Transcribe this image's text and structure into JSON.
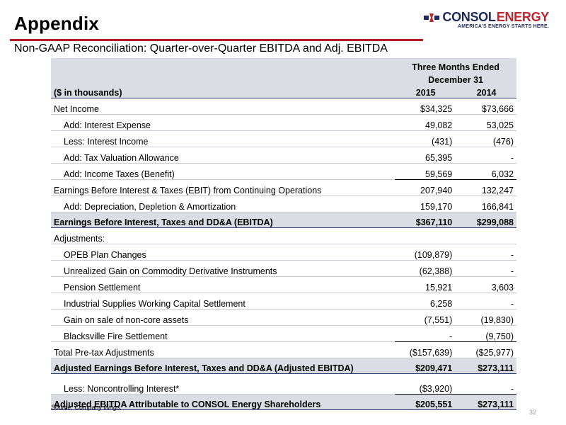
{
  "header": {
    "title": "Appendix",
    "subtitle": "Non-GAAP Reconciliation: Quarter-over-Quarter EBITDA and Adj. EBITDA"
  },
  "logo": {
    "name_part1": "CONSOL",
    "name_part2": "ENERGY",
    "tagline": "AMERICA'S ENERGY STARTS HERE.",
    "brand_red": "#c0262d",
    "brand_blue": "#1f2a5a"
  },
  "table": {
    "period_header_line1": "Three Months Ended",
    "period_header_line2": "December 31",
    "units_label": "($ in thousands)",
    "col_2015": "2015",
    "col_2014": "2014",
    "rows": [
      {
        "label": "Net Income",
        "v2015": "$34,325",
        "v2014": "$73,666"
      },
      {
        "label": "Add: Interest Expense",
        "v2015": "49,082",
        "v2014": "53,025"
      },
      {
        "label": "Less: Interest Income",
        "v2015": "(431)",
        "v2014": "(476)"
      },
      {
        "label": "Add: Tax Valuation Allowance",
        "v2015": "65,395",
        "v2014": "-"
      },
      {
        "label": "Add: Income Taxes (Benefit)",
        "v2015": "59,569",
        "v2014": "6,032"
      },
      {
        "label": "Earnings Before Interest & Taxes  (EBIT) from Continuing Operations",
        "v2015": "207,940",
        "v2014": "132,247"
      },
      {
        "label": "Add: Depreciation, Depletion & Amortization",
        "v2015": "159,170",
        "v2014": "166,841"
      },
      {
        "label": "Earnings Before Interest, Taxes and DD&A (EBITDA)",
        "v2015": "$367,110",
        "v2014": "$299,088"
      },
      {
        "label": "Adjustments:",
        "v2015": "",
        "v2014": ""
      },
      {
        "label": "OPEB Plan Changes",
        "v2015": "(109,879)",
        "v2014": "-"
      },
      {
        "label": "Unrealized Gain on Commodity Derivative Instruments",
        "v2015": "(62,388)",
        "v2014": "-"
      },
      {
        "label": "Pension Settlement",
        "v2015": "15,921",
        "v2014": "3,603"
      },
      {
        "label": "Industrial Supplies Working Capital Settlement",
        "v2015": "6,258",
        "v2014": "-"
      },
      {
        "label": "Gain on sale of non-core assets",
        "v2015": "(7,551)",
        "v2014": "(19,830)"
      },
      {
        "label": "Blacksville Fire Settlement",
        "v2015": "-",
        "v2014": "(9,750)"
      },
      {
        "label": "Total Pre-tax Adjustments",
        "v2015": "($157,639)",
        "v2014": "($25,977)"
      },
      {
        "label": "Adjusted Earnings Before Interest, Taxes and DD&A (Adjusted EBITDA)",
        "v2015": "$209,471",
        "v2014": "$273,111"
      },
      {
        "label": "Less: Noncontrolling Interest*",
        "v2015": "($3,920)",
        "v2014": "-"
      },
      {
        "label": "Adjusted EBITDA Attributable to CONSOL Energy Shareholders",
        "v2015": "$205,551",
        "v2014": "$273,111"
      }
    ]
  },
  "footer": {
    "source": "Source:  Company filings.",
    "page_number": "32"
  }
}
